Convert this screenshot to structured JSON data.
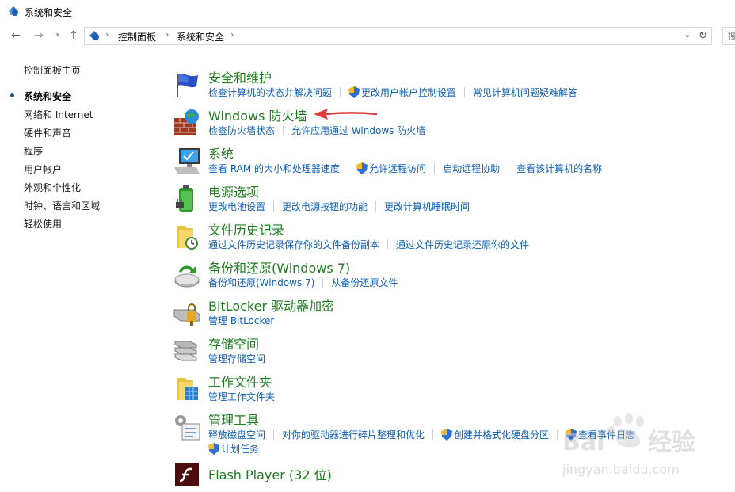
{
  "window": {
    "title": "系统和安全"
  },
  "nav": {
    "back_icon": "arrow-left-icon",
    "forward_icon": "arrow-right-icon",
    "recent_icon": "chevron-down-icon",
    "up_icon": "arrow-up-icon",
    "breadcrumb": [
      "控制面板",
      "系统和安全"
    ],
    "refresh_icon": "refresh-icon",
    "search_placeholder": "搜"
  },
  "sidebar": {
    "items": [
      {
        "label": "控制面板主页",
        "current": false
      },
      {
        "label": "系统和安全",
        "current": true
      },
      {
        "label": "网络和 Internet",
        "current": false
      },
      {
        "label": "硬件和声音",
        "current": false
      },
      {
        "label": "程序",
        "current": false
      },
      {
        "label": "用户帐户",
        "current": false
      },
      {
        "label": "外观和个性化",
        "current": false
      },
      {
        "label": "时钟、语言和区域",
        "current": false
      },
      {
        "label": "轻松使用",
        "current": false
      }
    ]
  },
  "categories": [
    {
      "title": "安全和维护",
      "icon": "flag-icon",
      "links": [
        "检查计算机的状态并解决问题",
        "更改用户帐户控制设置",
        "常见计算机问题疑难解答"
      ]
    },
    {
      "title": "Windows 防火墙",
      "icon": "firewall-icon",
      "links": [
        "检查防火墙状态",
        "允许应用通过 Windows 防火墙"
      ]
    },
    {
      "title": "系统",
      "icon": "computer-icon",
      "links": [
        "查看 RAM 的大小和处理器速度",
        "允许远程访问",
        "启动远程协助",
        "查看该计算机的名称"
      ]
    },
    {
      "title": "电源选项",
      "icon": "battery-icon",
      "links": [
        "更改电池设置",
        "更改电源按钮的功能",
        "更改计算机睡眠时间"
      ]
    },
    {
      "title": "文件历史记录",
      "icon": "folder-clock-icon",
      "links": [
        "通过文件历史记录保存你的文件备份副本",
        "通过文件历史记录还原你的文件"
      ]
    },
    {
      "title": "备份和还原(Windows 7)",
      "icon": "backup-icon",
      "links": [
        "备份和还原(Windows 7)",
        "从备份还原文件"
      ]
    },
    {
      "title": "BitLocker 驱动器加密",
      "icon": "lock-drive-icon",
      "links": [
        "管理 BitLocker"
      ]
    },
    {
      "title": "存储空间",
      "icon": "storage-icon",
      "links": [
        "管理存储空间"
      ]
    },
    {
      "title": "工作文件夹",
      "icon": "work-folder-icon",
      "links": [
        "管理工作文件夹"
      ]
    },
    {
      "title": "管理工具",
      "icon": "tools-icon",
      "links": [
        "释放磁盘空间",
        "对你的驱动器进行碎片整理和优化",
        "创建并格式化硬盘分区",
        "查看事件日志",
        "计划任务"
      ]
    },
    {
      "title": "Flash Player (32 位)",
      "icon": "flash-icon",
      "links": []
    }
  ],
  "watermark": {
    "text": "Baidu 经验",
    "url_text": "jingyan.baidu.com"
  },
  "colors": {
    "heading": "#1e7d1e",
    "link": "#0f5fb4",
    "arrow": "#e23b3b"
  }
}
